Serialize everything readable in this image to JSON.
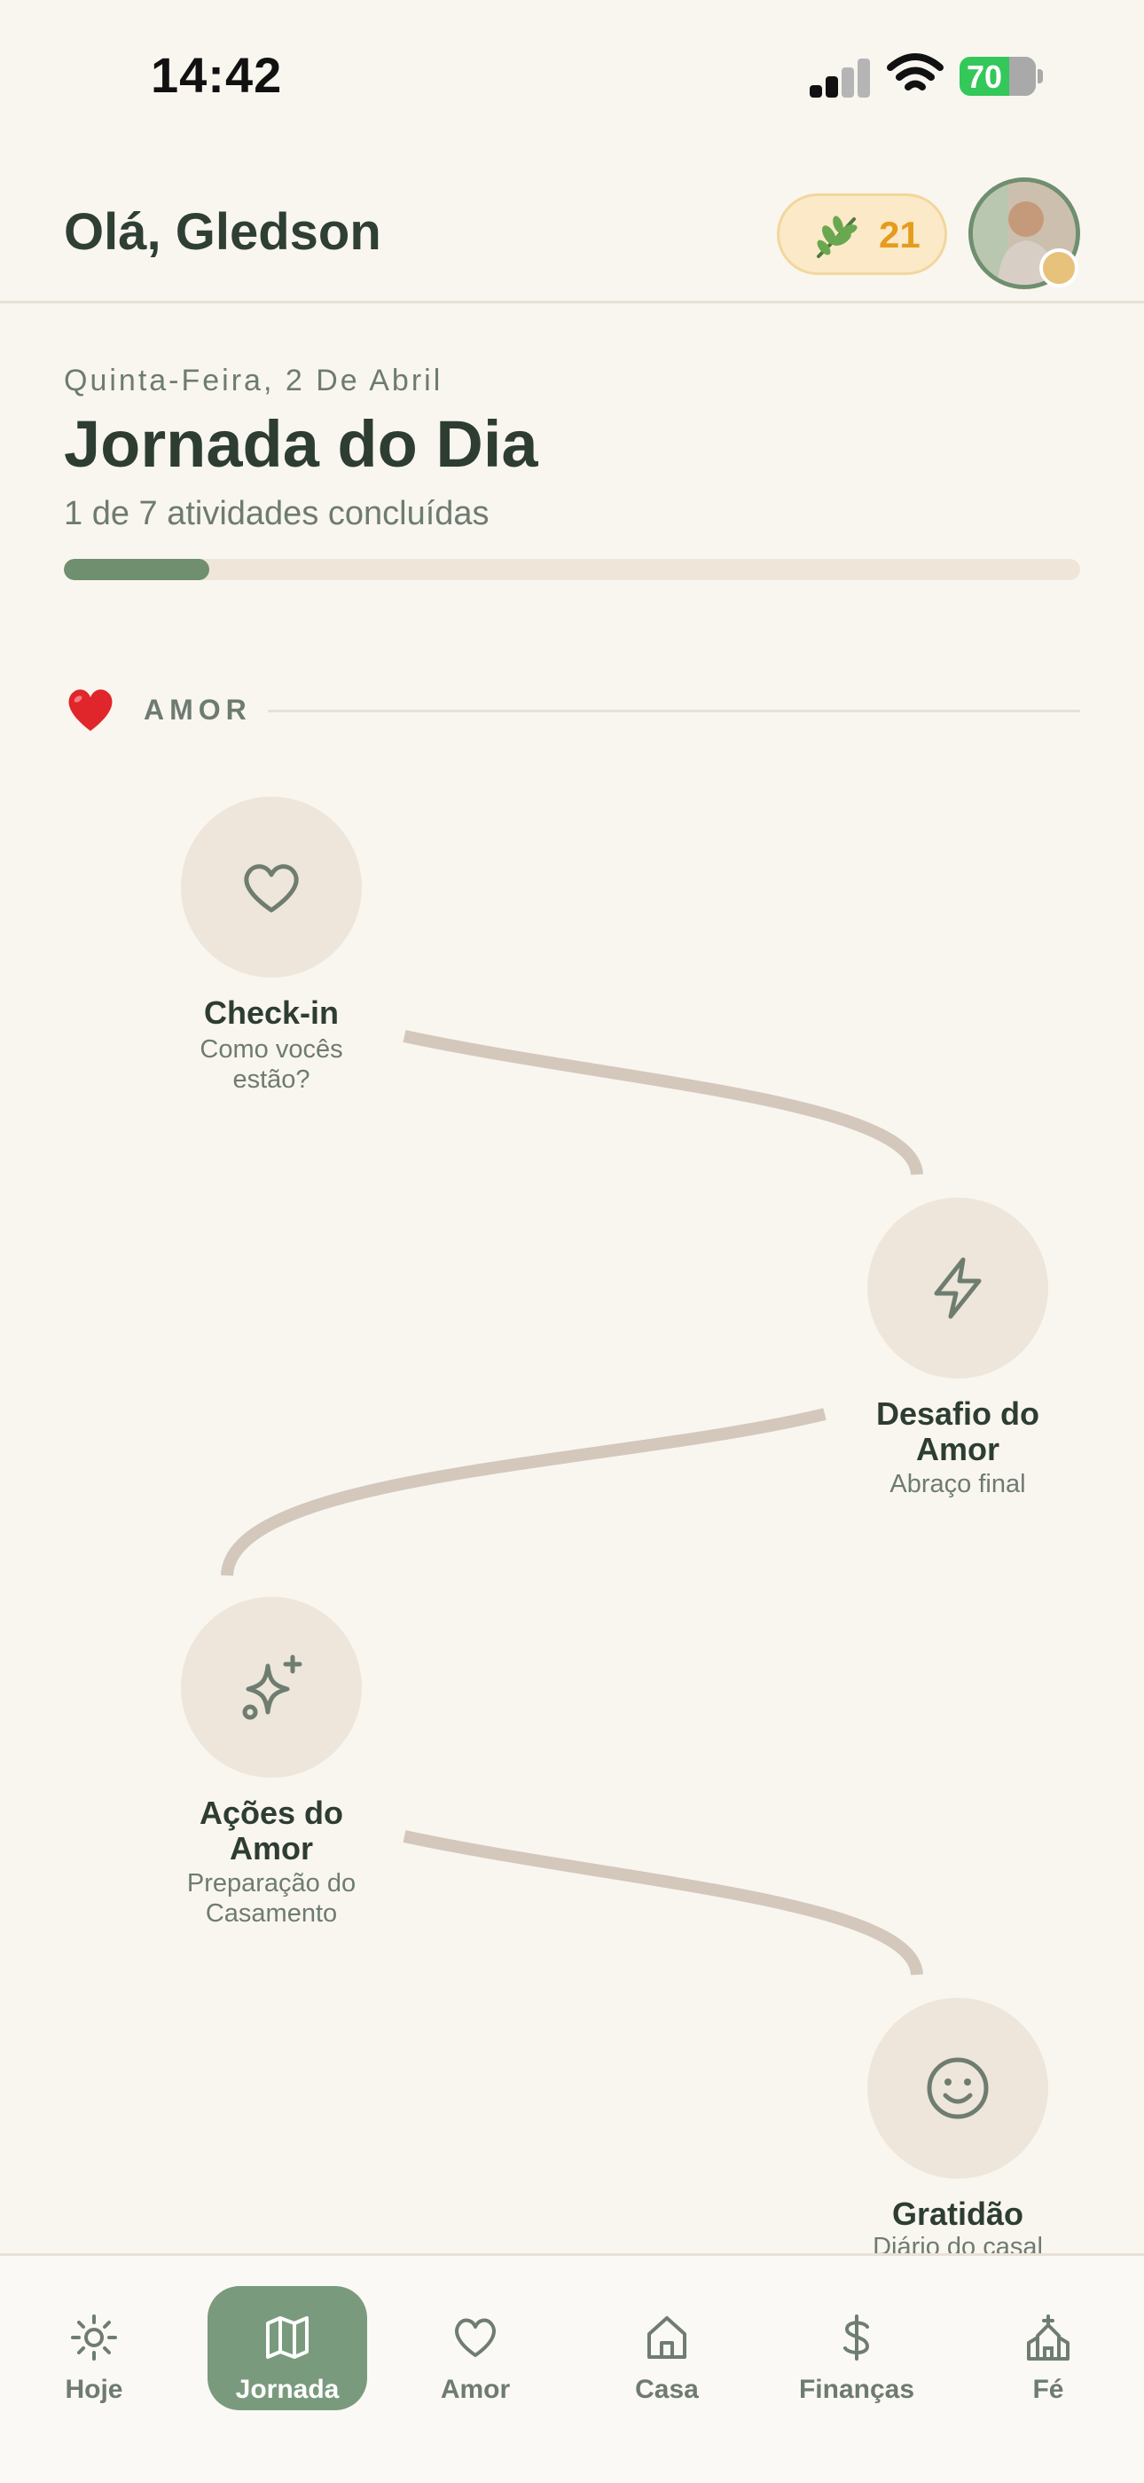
{
  "status_bar": {
    "time": "14:42",
    "battery": "70"
  },
  "header": {
    "greeting": "Olá, Gledson",
    "points": "21"
  },
  "day": {
    "date": "Quinta-Feira, 2 De Abril",
    "title": "Jornada do Dia",
    "progress_text": "1 de 7 atividades concluídas",
    "completed": 1,
    "total": 7
  },
  "section": {
    "label": "AMOR",
    "icon": "heart-emoji-icon"
  },
  "activities": [
    {
      "title": "Check-in",
      "subtitle": "Como vocês estão?",
      "icon": "heart-outline-icon"
    },
    {
      "title": "Desafio do Amor",
      "subtitle": "Abraço final",
      "icon": "lightning-icon"
    },
    {
      "title": "Ações do Amor",
      "subtitle": "Preparação do Casamento",
      "icon": "sparkles-icon"
    },
    {
      "title": "Gratidão",
      "subtitle": "Diário do casal",
      "icon": "smiley-icon"
    }
  ],
  "nav": {
    "items": [
      {
        "label": "Hoje",
        "icon": "sun-icon"
      },
      {
        "label": "Jornada",
        "icon": "map-icon"
      },
      {
        "label": "Amor",
        "icon": "heart-icon"
      },
      {
        "label": "Casa",
        "icon": "house-icon"
      },
      {
        "label": "Finanças",
        "icon": "dollar-icon"
      },
      {
        "label": "Fé",
        "icon": "church-icon"
      }
    ],
    "active": "Jornada"
  },
  "colors": {
    "accent": "#6f8f6f",
    "points": "#e59c1c",
    "node": "#eee6da",
    "path": "#d3c8bb"
  }
}
